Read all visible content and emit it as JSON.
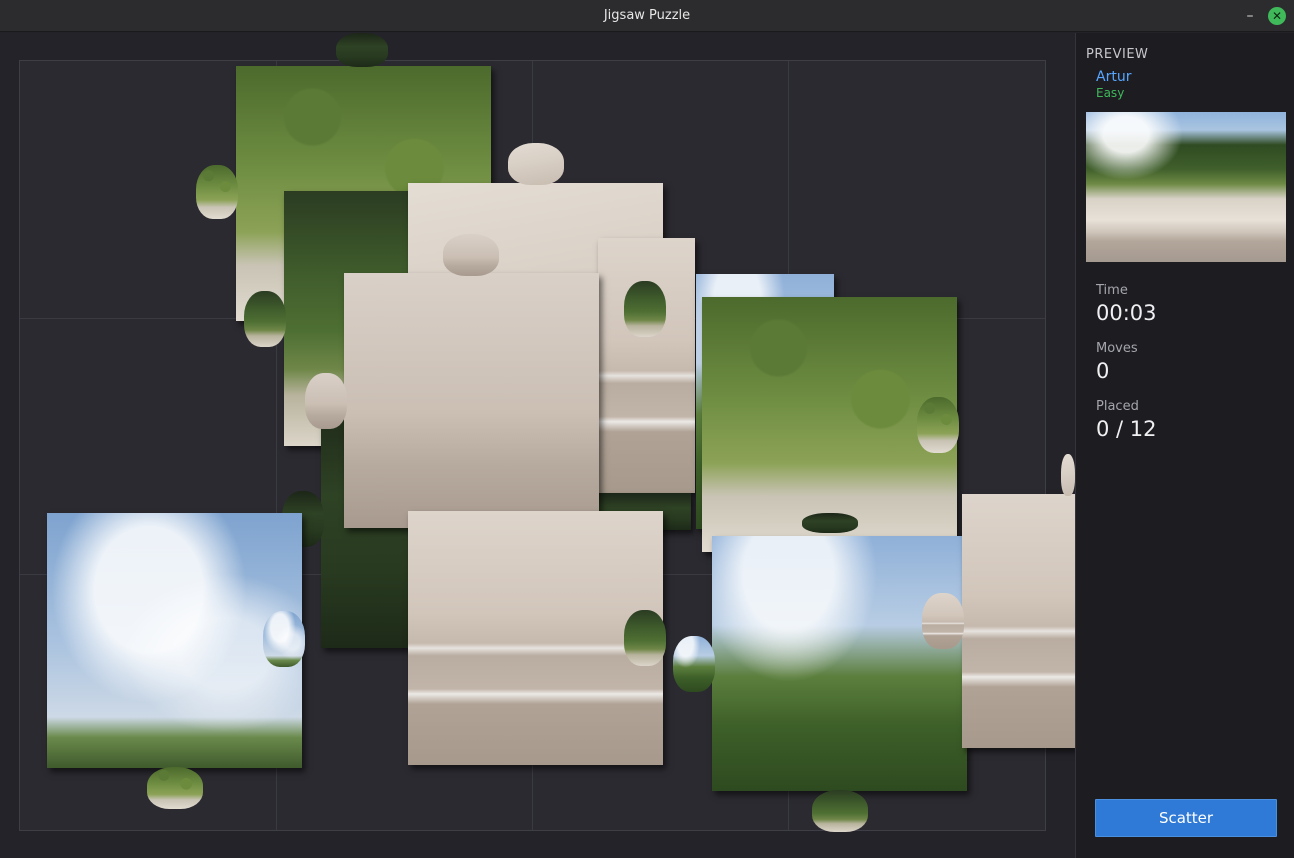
{
  "window": {
    "title": "Jigsaw Puzzle",
    "minimize_icon": "minimize-icon",
    "close_icon": "close-icon"
  },
  "board": {
    "grid_columns": 4,
    "grid_rows": 3
  },
  "sidebar": {
    "preview_label": "PREVIEW",
    "user_name": "Artur",
    "difficulty": "Easy",
    "time_label": "Time",
    "time_value": "00:03",
    "moves_label": "Moves",
    "moves_value": "0",
    "placed_label": "Placed",
    "placed_value": "0 / 12",
    "scatter_label": "Scatter"
  },
  "colors": {
    "accent": "#2f7ad6",
    "user": "#58a6ff",
    "difficulty": "#3fb95a",
    "close": "#3fb95a"
  }
}
